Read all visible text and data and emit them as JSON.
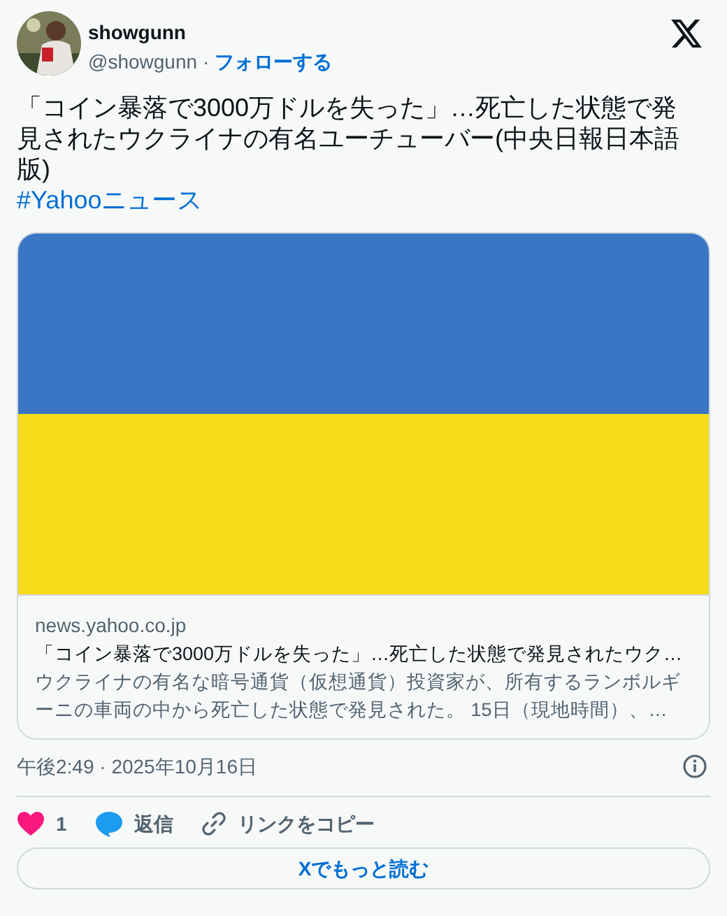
{
  "author": {
    "name": "showgunn",
    "handle": "@showgunn",
    "separator": "·",
    "follow": "フォローする"
  },
  "tweet": {
    "text": "「コイン暴落で3000万ドルを失った」…死亡した状態で発見されたウクライナの有名ユーチューバー(中央日報日本語版)",
    "hashtag": "#Yahooニュース"
  },
  "card": {
    "domain": "news.yahoo.co.jp",
    "title": "「コイン暴落で3000万ドルを失った」…死亡した状態で発見されたウク…",
    "description": "ウクライナの有名な暗号通貨（仮想通貨）投資家が、所有するランボルギーニの車両の中から死亡した状態で発見された。 15日（現地時間）、…"
  },
  "timestamp": "午後2:49 · 2025年10月16日",
  "actions": [
    {
      "kind": "like",
      "label": "1"
    },
    {
      "kind": "reply",
      "label": "返信"
    },
    {
      "kind": "copy",
      "label": "リンクをコピー"
    }
  ],
  "read_more": "Xでもっと読む"
}
